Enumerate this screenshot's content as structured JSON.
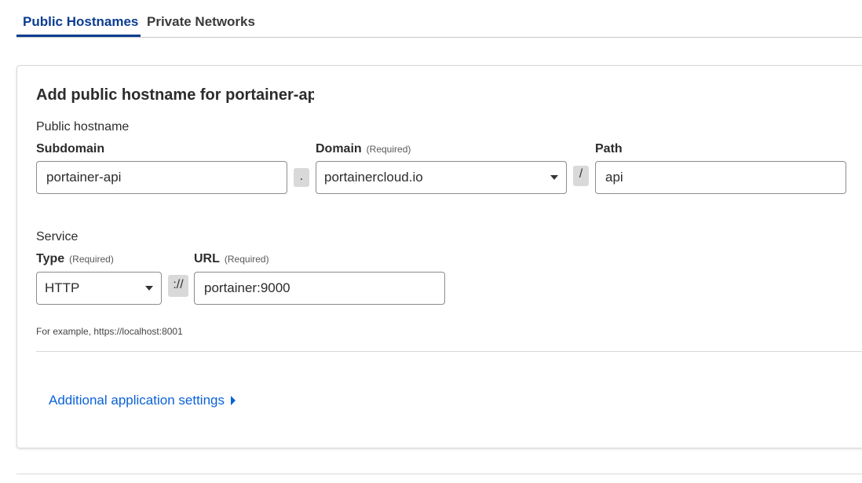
{
  "tabs": [
    {
      "label": "Public Hostnames",
      "active": true
    },
    {
      "label": "Private Networks",
      "active": false
    }
  ],
  "form": {
    "title": "Add public hostname for portainer-api",
    "hostname_section": "Public hostname",
    "subdomain": {
      "label": "Subdomain",
      "value": "portainer-api"
    },
    "dot_separator": ".",
    "domain": {
      "label": "Domain",
      "required": "(Required)",
      "value": "portainercloud.io"
    },
    "slash_separator": "/",
    "path": {
      "label": "Path",
      "value": "api"
    },
    "service_section": "Service",
    "type": {
      "label": "Type",
      "required": "(Required)",
      "value": "HTTP"
    },
    "scheme_separator": "://",
    "url": {
      "label": "URL",
      "required": "(Required)",
      "value": "portainer:9000"
    },
    "hint": "For example, https://localhost:8001",
    "additional_settings_link": "Additional application settings"
  },
  "colors": {
    "accent": "#0b3d91",
    "link": "#0a62d8",
    "border": "#8c8c8c"
  }
}
